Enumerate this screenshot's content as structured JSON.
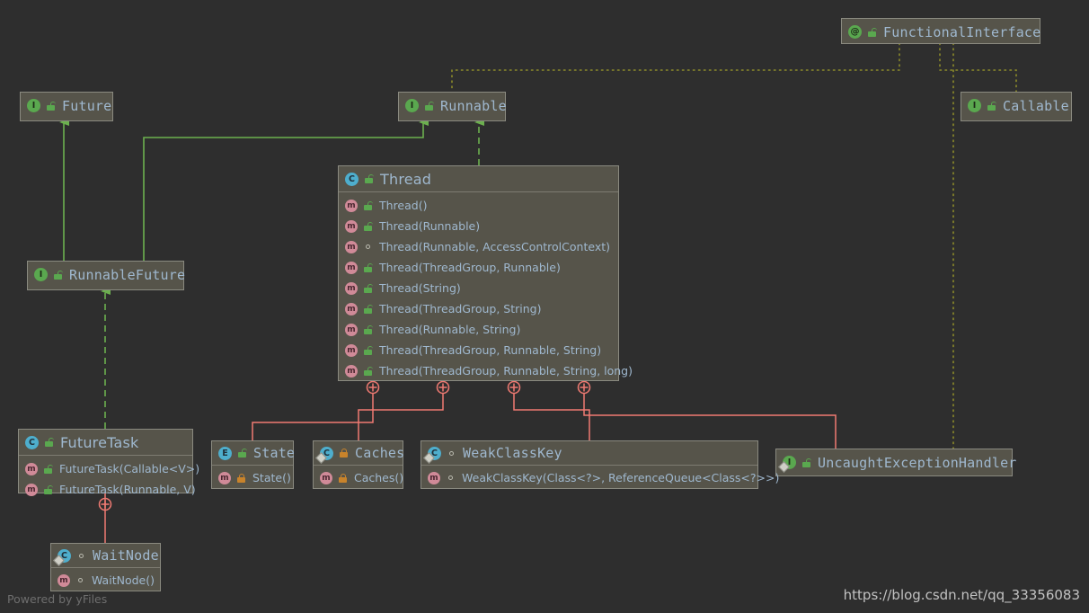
{
  "diagram": {
    "title": "Thread class hierarchy diagram",
    "background": "#2e2e2e",
    "colors": {
      "node_fill": "#56544a",
      "node_border": "#8a8a80",
      "text": "#9fb8cf",
      "inheritance_link": "#6cb04f",
      "inner_class_link": "#f07a72",
      "annotation_link": "#8d8c2a",
      "class_icon": "#4eaecd",
      "interface_icon": "#5aa84f",
      "method_icon": "#d08a98",
      "lock_public": "#5aa84f",
      "lock_private": "#c8832b"
    }
  },
  "nodes": {
    "future": {
      "name": "Future",
      "kind_icon": "interface-icon",
      "kind_letter": "I",
      "visibility_icon": "unlocked-green-icon"
    },
    "runnable": {
      "name": "Runnable",
      "kind_icon": "interface-icon",
      "kind_letter": "I",
      "visibility_icon": "unlocked-green-icon"
    },
    "functional_interface": {
      "name": "FunctionalInterface",
      "kind_icon": "annotation-icon",
      "kind_letter": "@",
      "visibility_icon": "unlocked-green-icon"
    },
    "callable": {
      "name": "Callable",
      "kind_icon": "interface-icon",
      "kind_letter": "I",
      "visibility_icon": "unlocked-green-icon"
    },
    "runnable_future": {
      "name": "RunnableFuture",
      "kind_icon": "interface-icon",
      "kind_letter": "I",
      "visibility_icon": "unlocked-green-icon"
    },
    "uncaught_exception_handler": {
      "name": "UncaughtExceptionHandler",
      "kind_icon": "nested-interface-icon",
      "kind_letter": "I",
      "visibility_icon": "unlocked-green-icon"
    },
    "thread": {
      "name": "Thread",
      "kind_icon": "class-icon",
      "kind_letter": "C",
      "visibility_icon": "unlocked-green-icon",
      "members": [
        {
          "label": "Thread()",
          "icon": "method-icon",
          "visibility_icon": "unlocked-green-icon"
        },
        {
          "label": "Thread(Runnable)",
          "icon": "method-icon",
          "visibility_icon": "unlocked-green-icon"
        },
        {
          "label": "Thread(Runnable, AccessControlContext)",
          "icon": "method-icon",
          "visibility_icon": "package-dot-icon"
        },
        {
          "label": "Thread(ThreadGroup, Runnable)",
          "icon": "method-icon",
          "visibility_icon": "unlocked-green-icon"
        },
        {
          "label": "Thread(String)",
          "icon": "method-icon",
          "visibility_icon": "unlocked-green-icon"
        },
        {
          "label": "Thread(ThreadGroup, String)",
          "icon": "method-icon",
          "visibility_icon": "unlocked-green-icon"
        },
        {
          "label": "Thread(Runnable, String)",
          "icon": "method-icon",
          "visibility_icon": "unlocked-green-icon"
        },
        {
          "label": "Thread(ThreadGroup, Runnable, String)",
          "icon": "method-icon",
          "visibility_icon": "unlocked-green-icon"
        },
        {
          "label": "Thread(ThreadGroup, Runnable, String, long)",
          "icon": "method-icon",
          "visibility_icon": "unlocked-green-icon"
        }
      ]
    },
    "future_task": {
      "name": "FutureTask",
      "kind_icon": "class-icon",
      "kind_letter": "C",
      "visibility_icon": "unlocked-green-icon",
      "members": [
        {
          "label": "FutureTask(Callable<V>)",
          "icon": "method-icon",
          "visibility_icon": "unlocked-green-icon"
        },
        {
          "label": "FutureTask(Runnable, V)",
          "icon": "method-icon",
          "visibility_icon": "unlocked-green-icon"
        }
      ]
    },
    "state": {
      "name": "State",
      "kind_icon": "enum-icon",
      "kind_letter": "E",
      "visibility_icon": "unlocked-green-icon",
      "members": [
        {
          "label": "State()",
          "icon": "method-icon",
          "visibility_icon": "locked-orange-icon"
        }
      ]
    },
    "caches": {
      "name": "Caches",
      "kind_icon": "nested-class-icon",
      "kind_letter": "C",
      "visibility_icon": "locked-orange-icon",
      "members": [
        {
          "label": "Caches()",
          "icon": "method-icon",
          "visibility_icon": "locked-orange-icon"
        }
      ]
    },
    "weak_class_key": {
      "name": "WeakClassKey",
      "kind_icon": "nested-class-icon",
      "kind_letter": "C",
      "visibility_icon": "package-dot-icon",
      "members": [
        {
          "label": "WeakClassKey(Class<?>, ReferenceQueue<Class<?>>)",
          "icon": "method-icon",
          "visibility_icon": "package-dot-icon"
        }
      ]
    },
    "wait_node": {
      "name": "WaitNode",
      "kind_icon": "nested-class-icon",
      "kind_letter": "C",
      "visibility_icon": "package-dot-icon",
      "members": [
        {
          "label": "WaitNode()",
          "icon": "method-icon",
          "visibility_icon": "package-dot-icon"
        }
      ]
    }
  },
  "watermarks": {
    "yfiles": "Powered by yFiles",
    "blog_url": "https://blog.csdn.net/qq_33356083"
  }
}
